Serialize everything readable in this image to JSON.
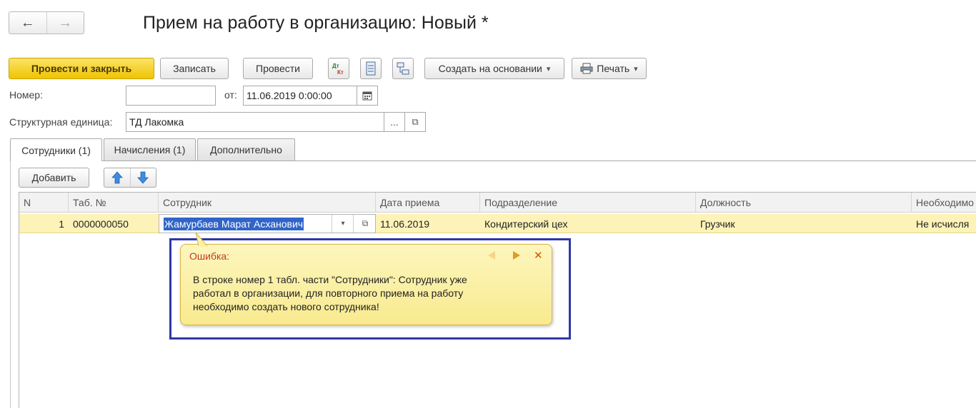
{
  "window": {
    "title": "Прием на работу в организацию: Новый *"
  },
  "nav": {
    "back_glyph": "←",
    "forward_glyph": "→"
  },
  "toolbar": {
    "post_and_close": "Провести и закрыть",
    "save": "Записать",
    "post": "Провести",
    "create_based_on": "Создать на основании",
    "print": "Печать",
    "dropdown_glyph": "▾"
  },
  "form": {
    "number_label": "Номер:",
    "number_value": "",
    "from_label": "от:",
    "date_value": "11.06.2019  0:00:00",
    "unit_label": "Структурная единица:",
    "unit_value": "ТД Лакомка",
    "select_glyph": "...",
    "open_glyph": "⧉"
  },
  "tabs": [
    {
      "label": "Сотрудники (1)",
      "active": true
    },
    {
      "label": "Начисления (1)",
      "active": false
    },
    {
      "label": "Дополнительно",
      "active": false
    }
  ],
  "table_toolbar": {
    "add": "Добавить"
  },
  "table": {
    "columns": [
      "N",
      "Таб. №",
      "Сотрудник",
      "Дата приема",
      "Подразделение",
      "Должность",
      "Необходимо"
    ],
    "rows": [
      {
        "n": "1",
        "tab_no": "0000000050",
        "employee": "Жамурбаев Марат Асханович",
        "hire_date": "11.06.2019",
        "department": "Кондитерский цех",
        "position": "Грузчик",
        "required": "Не исчисля"
      }
    ]
  },
  "error_popup": {
    "title": "Ошибка:",
    "message": "В строке номер 1 табл. части \"Сотрудники\": Сотрудник уже работал в организации, для повторного приема на работу необходимо создать нового сотрудника!",
    "close_glyph": "✕"
  },
  "colors": {
    "accent_yellow": "#f5d21f",
    "row_highlight": "#fdf3b9",
    "popup_bg": "#fbf1a7",
    "popup_border": "#d8b64a",
    "frame_blue": "#2e38a6",
    "error_title": "#c0392b"
  }
}
